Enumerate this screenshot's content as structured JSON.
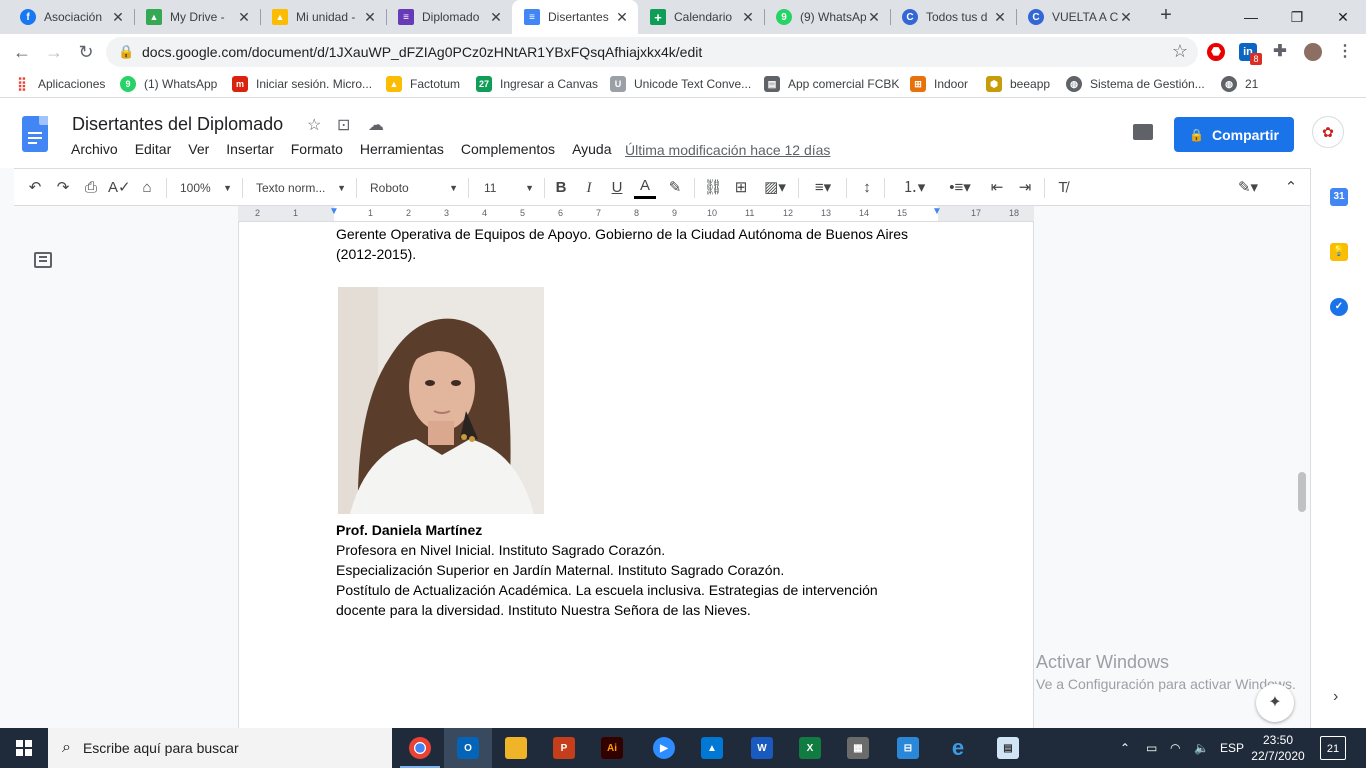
{
  "browser": {
    "tabs": [
      {
        "label": "Asociación",
        "icon": "facebook-icon",
        "color": "#1877f2",
        "glyph": "f"
      },
      {
        "label": "My Drive -",
        "icon": "drive-icon",
        "color": "#34a853",
        "glyph": "▲"
      },
      {
        "label": "Mi unidad -",
        "icon": "drive-icon",
        "color": "#fbbc04",
        "glyph": "▲"
      },
      {
        "label": "Diplomado",
        "icon": "forms-icon",
        "color": "#673ab7",
        "glyph": "≡"
      },
      {
        "label": "Disertantes",
        "icon": "docs-icon",
        "color": "#4285f4",
        "glyph": "≡",
        "active": true
      },
      {
        "label": "Calendario",
        "icon": "sheets-icon",
        "color": "#0f9d58",
        "glyph": "+"
      },
      {
        "label": "(9) WhatsAp",
        "icon": "whatsapp-icon",
        "color": "#25d366",
        "glyph": "9"
      },
      {
        "label": "Todos tus d",
        "icon": "canvas-icon",
        "color": "#3367d6",
        "glyph": "C"
      },
      {
        "label": "VUELTA A C",
        "icon": "canvas-icon",
        "color": "#3367d6",
        "glyph": "C"
      }
    ],
    "url": "docs.google.com/document/d/1JXauWP_dFZIAg0PCz0zHNtAR1YBxFQsqAfhiajxkx4k/edit",
    "extension_badge": "8",
    "bookmarks": [
      {
        "label": "Aplicaciones",
        "icon": "apps-grid-icon",
        "color": "#ea4335"
      },
      {
        "label": "(1) WhatsApp",
        "icon": "whatsapp-icon",
        "color": "#25d366"
      },
      {
        "label": "Iniciar sesión. Micro...",
        "icon": "moodle-icon",
        "color": "#d9230f"
      },
      {
        "label": "Factotum",
        "icon": "drive-icon",
        "color": "#fbbc04"
      },
      {
        "label": "Ingresar a Canvas",
        "icon": "calendar-icon",
        "color": "#0f9d58"
      },
      {
        "label": "Unicode Text Conve...",
        "icon": "unicode-icon",
        "color": "#9aa0a6"
      },
      {
        "label": "App comercial FCBK",
        "icon": "page-icon",
        "color": "#5f6368"
      },
      {
        "label": "Indoor",
        "icon": "indoor-icon",
        "color": "#e8710a"
      },
      {
        "label": "beeapp",
        "icon": "bee-icon",
        "color": "#c69c0a"
      },
      {
        "label": "Sistema de Gestión...",
        "icon": "globe-icon",
        "color": "#5f6368"
      },
      {
        "label": "21",
        "icon": "globe-icon",
        "color": "#5f6368"
      }
    ]
  },
  "docs": {
    "title": "Disertantes del Diplomado",
    "menu": [
      "Archivo",
      "Editar",
      "Ver",
      "Insertar",
      "Formato",
      "Herramientas",
      "Complementos",
      "Ayuda"
    ],
    "last_edit": "Última modificación hace 12 días",
    "share_label": "Compartir",
    "toolbar": {
      "zoom": "100%",
      "style": "Texto norm...",
      "font": "Roboto",
      "size": "11"
    },
    "ruler_numbers": [
      "2",
      "1",
      "1",
      "1",
      "2",
      "3",
      "4",
      "5",
      "6",
      "7",
      "8",
      "9",
      "10",
      "11",
      "12",
      "13",
      "14",
      "15",
      "16",
      "17",
      "18"
    ],
    "content": {
      "line1": "Gerente Operativa de Equipos de Apoyo. Gobierno de la Ciudad Autónoma de Buenos Aires",
      "line2": "(2012-2015).",
      "name": "Prof. Daniela Martínez",
      "bio1": "Profesora en Nivel Inicial. Instituto Sagrado Corazón.",
      "bio2": "Especialización Superior en Jardín Maternal. Instituto Sagrado Corazón.",
      "bio3": "Postítulo de Actualización Académica. La escuela inclusiva. Estrategias de intervención",
      "bio4": "docente para la diversidad. Instituto Nuestra Señora de las Nieves."
    }
  },
  "side_panel": {
    "calendar_label": "31"
  },
  "windows": {
    "activate_title": "Activar Windows",
    "activate_sub": "Ve a Configuración para activar Windows.",
    "search_placeholder": "Escribe aquí para buscar",
    "lang": "ESP",
    "time": "23:50",
    "date": "22/7/2020",
    "notifications": "21"
  }
}
